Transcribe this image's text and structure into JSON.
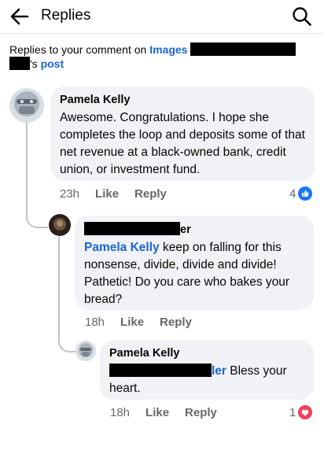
{
  "header": {
    "title": "Replies",
    "back_icon": "arrow-left-icon",
    "search_icon": "search-icon"
  },
  "context": {
    "prefix": "Replies to your comment on ",
    "page_link": "Images",
    "possessive": "'s ",
    "post_link": "post"
  },
  "comments": [
    {
      "author": "Pamela Kelly",
      "text": "Awesome. Congratulations. I hope she completes the loop and deposits some of that net revenue at a black-owned bank, credit union, or investment fund.",
      "time": "23h",
      "like_label": "Like",
      "reply_label": "Reply",
      "reaction_count": "4",
      "reaction_icon": "like-reaction-icon"
    },
    {
      "author_suffix": "er",
      "mention": "Pamela Kelly",
      "text": " keep on falling for this nonsense,  divide,  divide and divide! Pathetic! Do you care who bakes your bread?",
      "time": "18h",
      "like_label": "Like",
      "reply_label": "Reply"
    },
    {
      "author": "Pamela Kelly",
      "mention_suffix": "ler",
      "text": " Bless your heart.",
      "time": "18h",
      "like_label": "Like",
      "reply_label": "Reply",
      "reaction_count": "1",
      "reaction_icon": "love-reaction-icon"
    }
  ],
  "colors": {
    "link": "#1a66d6",
    "bubble": "#f0f2f5",
    "meta_text": "#65676b",
    "like_blue": "#1877f2",
    "love_red": "#f33e58"
  }
}
